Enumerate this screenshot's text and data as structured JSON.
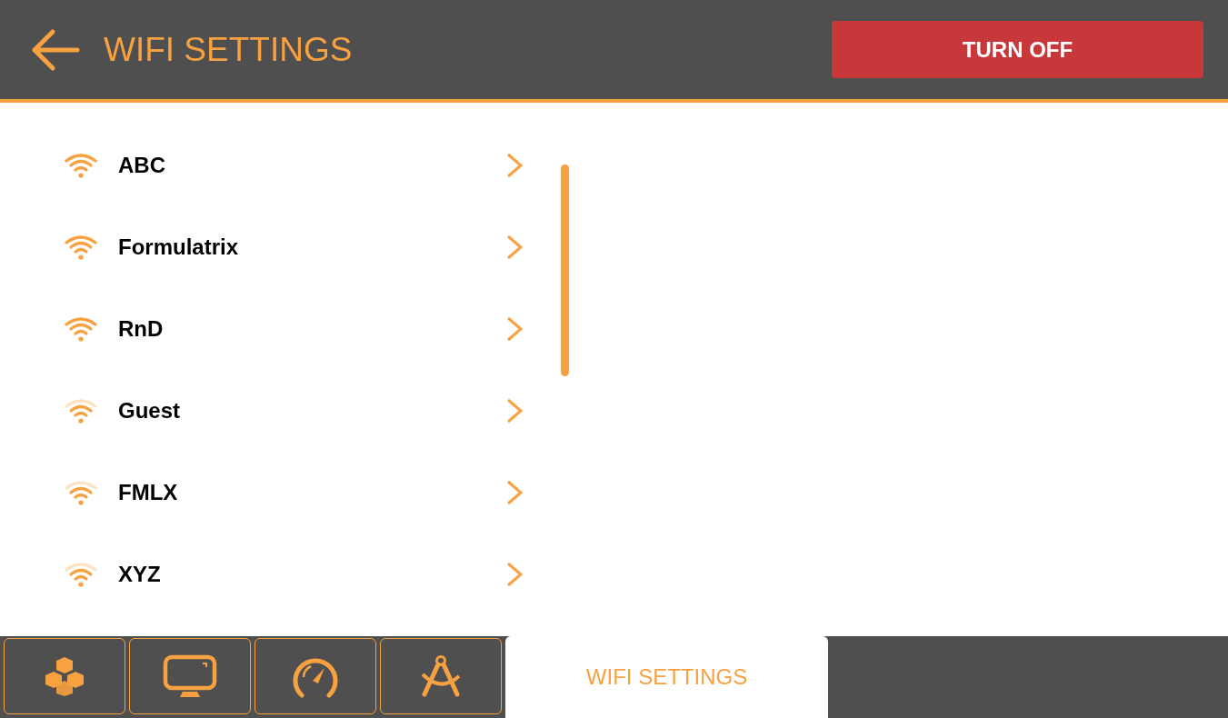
{
  "header": {
    "title": "WIFI SETTINGS",
    "button": "TURN OFF"
  },
  "networks": [
    {
      "name": "ABC",
      "kind": "strong"
    },
    {
      "name": "Formulatrix",
      "kind": "strong"
    },
    {
      "name": "RnD",
      "kind": "strong"
    },
    {
      "name": "Guest",
      "kind": "medium"
    },
    {
      "name": "FMLX",
      "kind": "medium"
    },
    {
      "name": "XYZ",
      "kind": "medium"
    }
  ],
  "tabs": [
    {
      "selected": false
    },
    {
      "selected": false
    },
    {
      "selected": false
    },
    {
      "selected": false
    },
    {
      "label": "WIFI SETTINGS",
      "selected": true
    }
  ]
}
